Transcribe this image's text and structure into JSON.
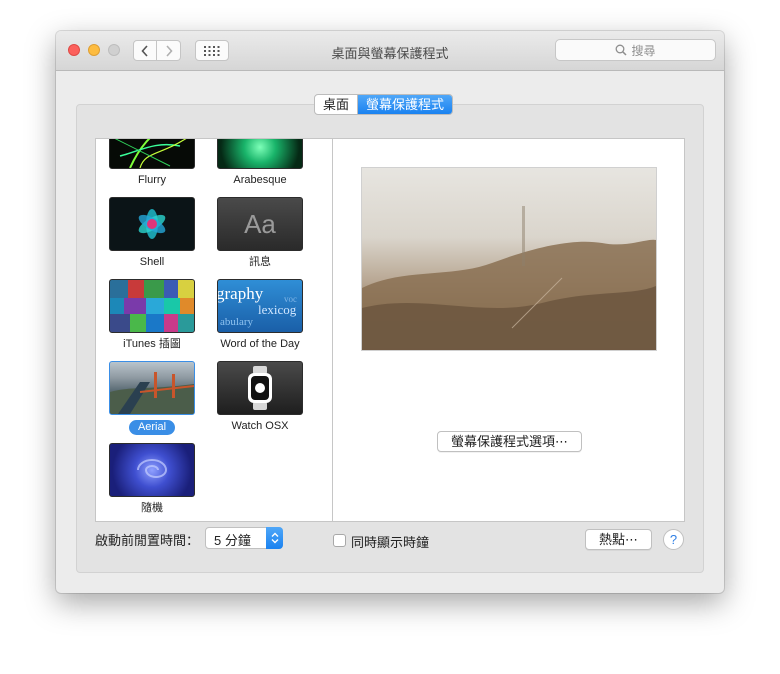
{
  "window": {
    "title": "桌面與螢幕保護程式"
  },
  "search": {
    "placeholder": "搜尋"
  },
  "tabs": [
    {
      "label": "桌面",
      "active": false
    },
    {
      "label": "螢幕保護程式",
      "active": true
    }
  ],
  "screensavers": [
    {
      "label": "Flurry"
    },
    {
      "label": "Arabesque"
    },
    {
      "label": "Shell"
    },
    {
      "label": "訊息",
      "thumb_text": "Aa"
    },
    {
      "label": "iTunes 插圖"
    },
    {
      "label": "Word of the Day",
      "thumb_words": [
        "graphy",
        "lexicog",
        "abulary",
        "voc"
      ]
    },
    {
      "label": "Aerial",
      "selected": true
    },
    {
      "label": "Watch OSX"
    },
    {
      "label": "隨機"
    }
  ],
  "preview": {
    "options_button": "螢幕保護程式選項⋯"
  },
  "bottom": {
    "idle_label": "啟動前閒置時間：",
    "idle_value": "5 分鐘",
    "show_clock_label": "同時顯示時鐘",
    "show_clock_checked": false,
    "hot_corners_button": "熱點⋯",
    "help_label": "?"
  },
  "colors": {
    "accent": "#1a82f0",
    "selection": "#3a8ee6"
  }
}
